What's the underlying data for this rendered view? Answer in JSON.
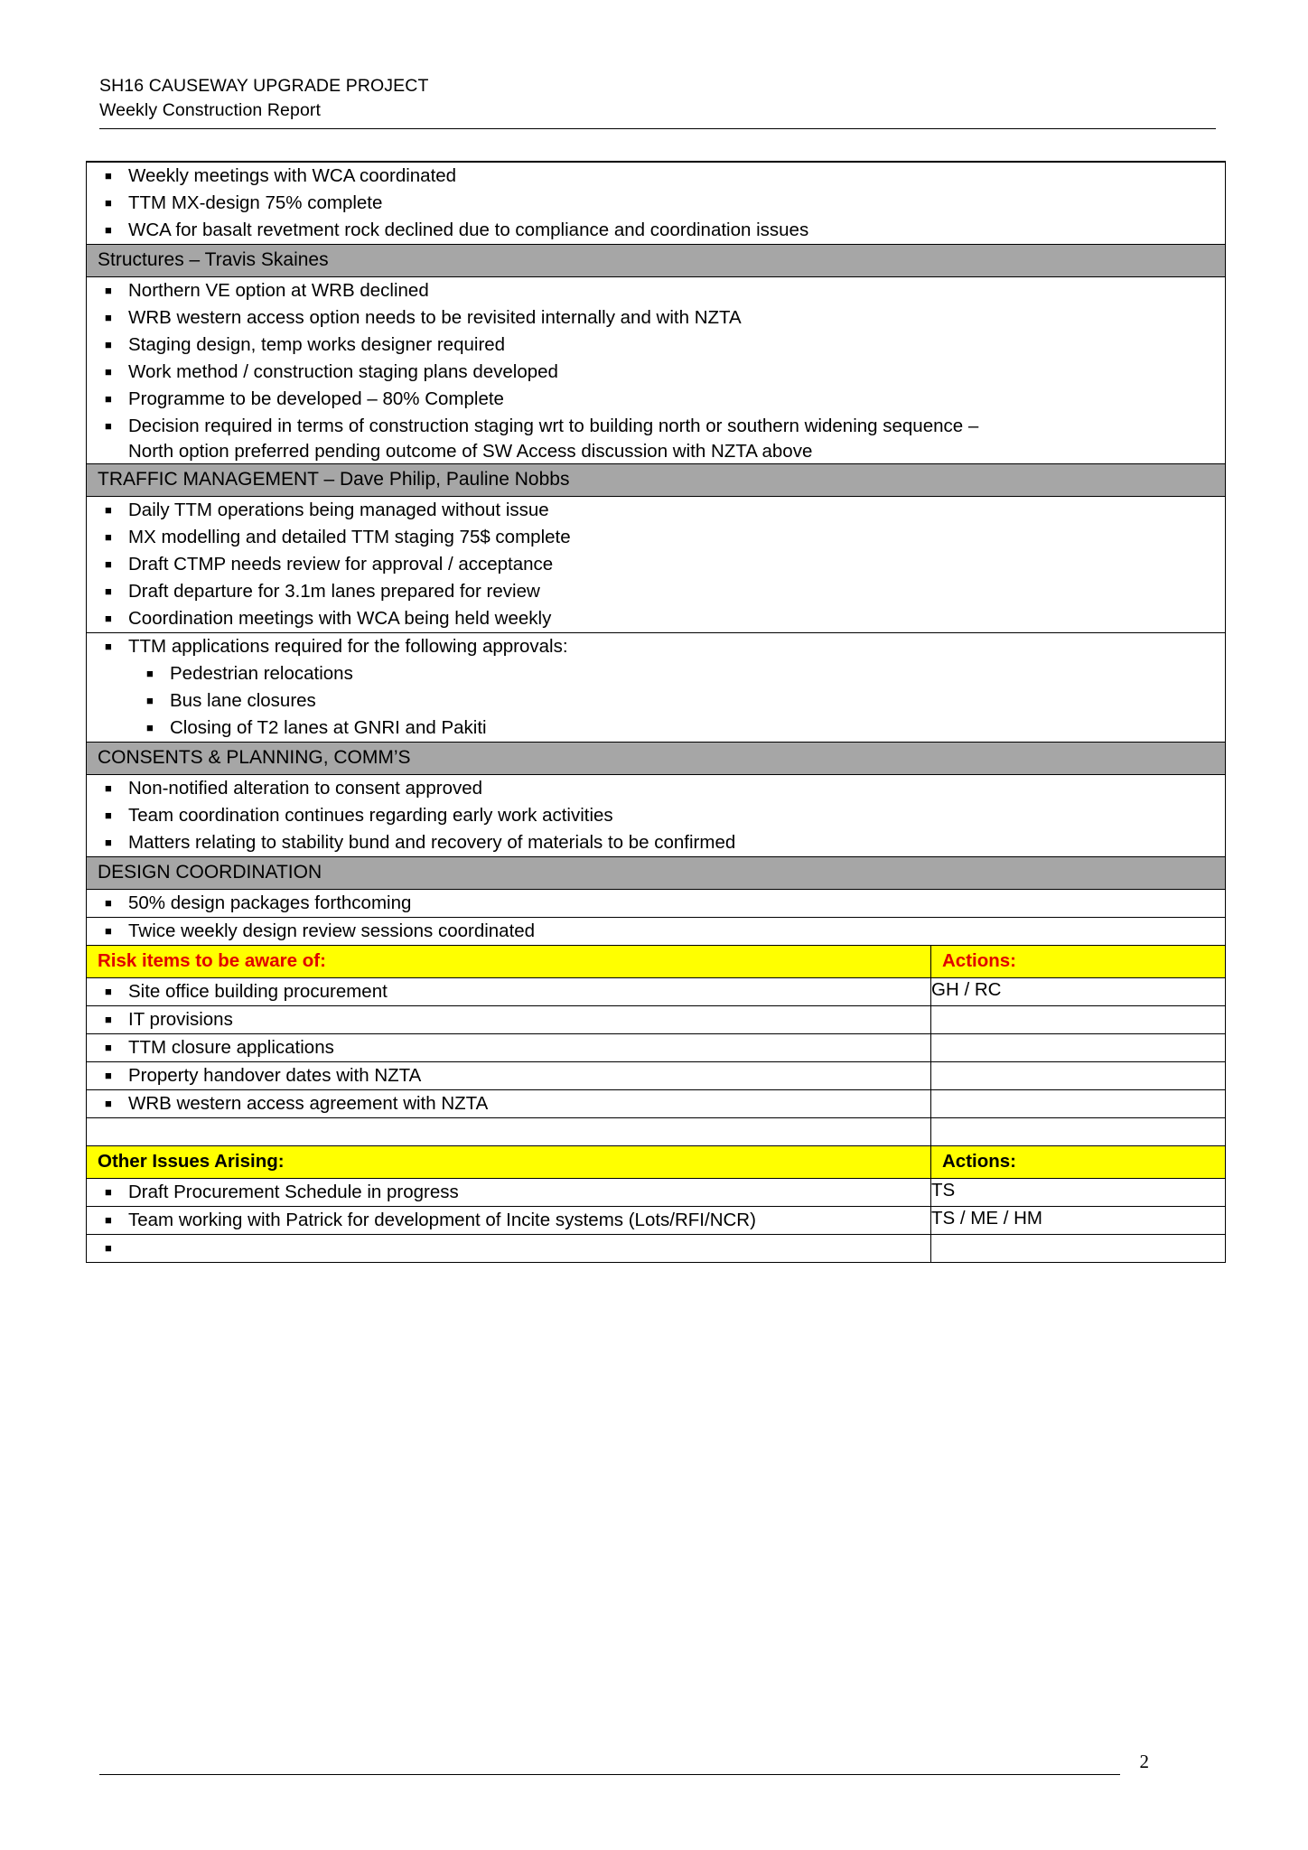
{
  "header": {
    "line1": "SH16 CAUSEWAY UPGRADE PROJECT",
    "line2": "Weekly Construction Report"
  },
  "footer": {
    "page_number": "2"
  },
  "colors": {
    "section_header_gray": "#a6a6a6",
    "highlight_yellow": "#ffff00",
    "risk_label_red": "#e00000"
  },
  "table": {
    "top_bullets": [
      "Weekly meetings with WCA coordinated",
      "TTM MX-design 75% complete",
      "WCA for basalt revetment rock declined due to compliance and coordination issues"
    ],
    "sections": [
      {
        "title": "Structures – Travis Skaines",
        "bullets": [
          "Northern VE option at WRB declined",
          "WRB western access option needs to be revisited internally and with NZTA",
          "Staging design, temp works designer required",
          "Work method / construction staging plans developed",
          "Programme to be developed – 80% Complete",
          "Decision required in terms of construction staging wrt to building north or southern widening sequence –"
        ],
        "continuation": "North option preferred pending outcome of SW Access discussion with NZTA above"
      },
      {
        "title": "TRAFFIC MANAGEMENT – Dave Philip, Pauline Nobbs",
        "bullets": [
          "Daily TTM operations being managed without issue",
          "MX modelling and detailed TTM staging 75$ complete",
          "Draft CTMP needs review for approval / acceptance",
          "Draft departure for 3.1m lanes prepared for review",
          "Coordination meetings with WCA being held weekly"
        ],
        "approvals_intro": "TTM applications required for the following approvals:",
        "approvals": [
          "Pedestrian relocations",
          "Bus lane closures",
          "Closing of T2 lanes at GNRI and Pakiti"
        ]
      },
      {
        "title": "CONSENTS & PLANNING, COMM’S",
        "bullets": [
          "Non-notified alteration to consent approved",
          "Team coordination continues regarding early work activities",
          "Matters relating to stability bund and recovery of materials to be confirmed"
        ]
      },
      {
        "title": "DESIGN COORDINATION",
        "bullets": [
          "50% design packages forthcoming",
          "Twice weekly design review sessions coordinated"
        ]
      }
    ],
    "risk_block": {
      "label": "Risk items to be aware of:",
      "actions_label": "Actions:",
      "rows": [
        {
          "item": "Site office building procurement",
          "action": "GH / RC"
        },
        {
          "item": "IT provisions",
          "action": ""
        },
        {
          "item": "TTM closure applications",
          "action": ""
        },
        {
          "item": "Property handover dates with NZTA",
          "action": ""
        },
        {
          "item": "WRB western access agreement with NZTA",
          "action": ""
        }
      ]
    },
    "other_issues_block": {
      "label": "Other Issues Arising:",
      "actions_label": "Actions:",
      "rows": [
        {
          "item": "Draft Procurement Schedule in progress",
          "action": "TS"
        },
        {
          "item": "Team working with Patrick for development of Incite systems (Lots/RFI/NCR)",
          "action": "TS / ME / HM"
        },
        {
          "item": "",
          "action": ""
        }
      ]
    }
  }
}
